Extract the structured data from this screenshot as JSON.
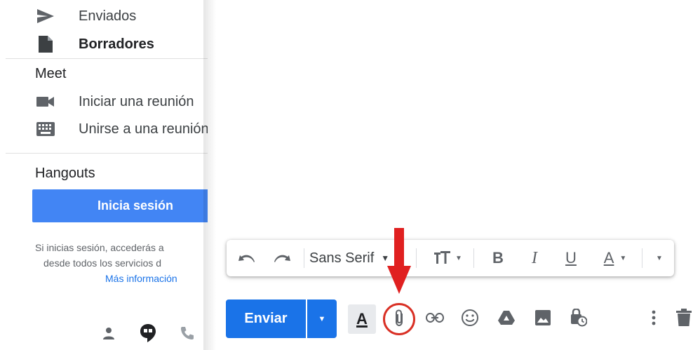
{
  "sidebar": {
    "items": [
      {
        "label": "Enviados",
        "icon": "send-icon"
      },
      {
        "label": "Borradores",
        "icon": "draft-icon",
        "bold": true
      }
    ],
    "meet": {
      "title": "Meet",
      "items": [
        {
          "label": "Iniciar una reunión",
          "icon": "video-camera-icon"
        },
        {
          "label": "Unirse a una reunión",
          "icon": "keyboard-icon"
        }
      ]
    },
    "hangouts": {
      "title": "Hangouts",
      "signin_label": "Inicia sesión",
      "hint_line1": "Si inicias sesión, accederás a",
      "hint_line2": "desde todos los servicios d",
      "more_info": "Más información"
    },
    "bottom_icons": [
      "person-icon",
      "hangouts-icon",
      "phone-icon"
    ]
  },
  "formatting_toolbar": {
    "font_name": "Sans Serif",
    "tools": [
      "undo-icon",
      "redo-icon",
      "font-select",
      "text-size-icon",
      "bold-icon",
      "italic-icon",
      "underline-icon",
      "text-color-icon",
      "more-formatting-icon"
    ],
    "bold_label": "B",
    "italic_label": "I",
    "underline_label": "U",
    "text_color_label": "A"
  },
  "compose_actions": {
    "send_label": "Enviar",
    "format_toggle_label": "A",
    "tools": [
      "formatting-options-icon",
      "attach-file-icon",
      "insert-link-icon",
      "insert-emoji-icon",
      "google-drive-icon",
      "insert-photo-icon",
      "confidential-mode-icon",
      "more-options-icon",
      "delete-icon"
    ]
  },
  "colors": {
    "primary_blue": "#1a73e8",
    "signin_blue": "#4285f4",
    "highlight_red": "#d93025"
  }
}
